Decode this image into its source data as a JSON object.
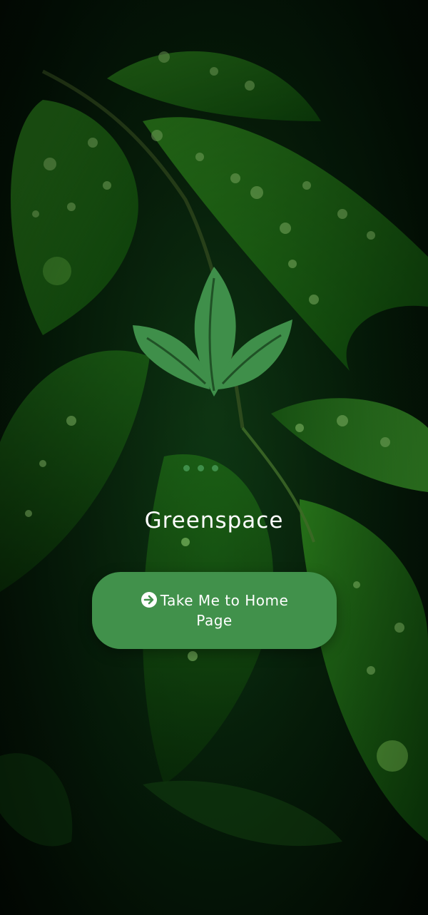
{
  "app": {
    "name": "Greenspace"
  },
  "splash": {
    "home_button_label": "Take Me to Home Page",
    "home_button_icon": "arrow-right-circle-icon",
    "logo_icon": "leaf-logo-icon",
    "background": "leaves-with-water-drops"
  },
  "colors": {
    "accent": "#41914b",
    "logo": "#3f8f4a",
    "text": "#ffffff"
  }
}
